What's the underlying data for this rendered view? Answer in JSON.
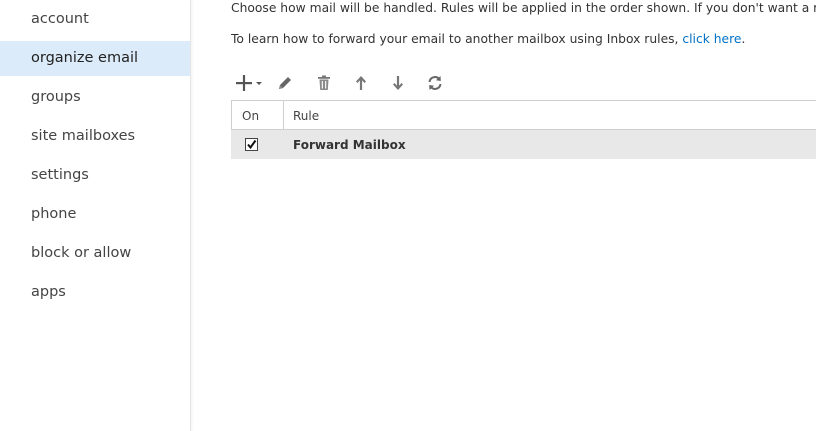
{
  "sidebar": {
    "items": [
      {
        "label": "account"
      },
      {
        "label": "organize email",
        "selected": true
      },
      {
        "label": "groups"
      },
      {
        "label": "site mailboxes"
      },
      {
        "label": "settings"
      },
      {
        "label": "phone"
      },
      {
        "label": "block or allow"
      },
      {
        "label": "apps"
      }
    ]
  },
  "main": {
    "description": "Choose how mail will be handled. Rules will be applied in the order shown. If you don't want a rule to run, you",
    "forward_text": "To learn how to forward your email to another mailbox using Inbox rules,",
    "forward_link": "click here",
    "forward_suffix": ".",
    "toolbar": {
      "icons": [
        "add-icon",
        "pencil-icon",
        "trash-icon",
        "arrow-up-icon",
        "arrow-down-icon",
        "refresh-icon"
      ]
    },
    "table": {
      "columns": [
        "On",
        "Rule"
      ],
      "rows": [
        {
          "on": true,
          "rule": "Forward Mailbox"
        }
      ]
    }
  },
  "colors": {
    "accent": "#0072c6",
    "selected_bg": "#dcebf9",
    "row_bg": "#e8e8e8",
    "icon": "#555555"
  }
}
